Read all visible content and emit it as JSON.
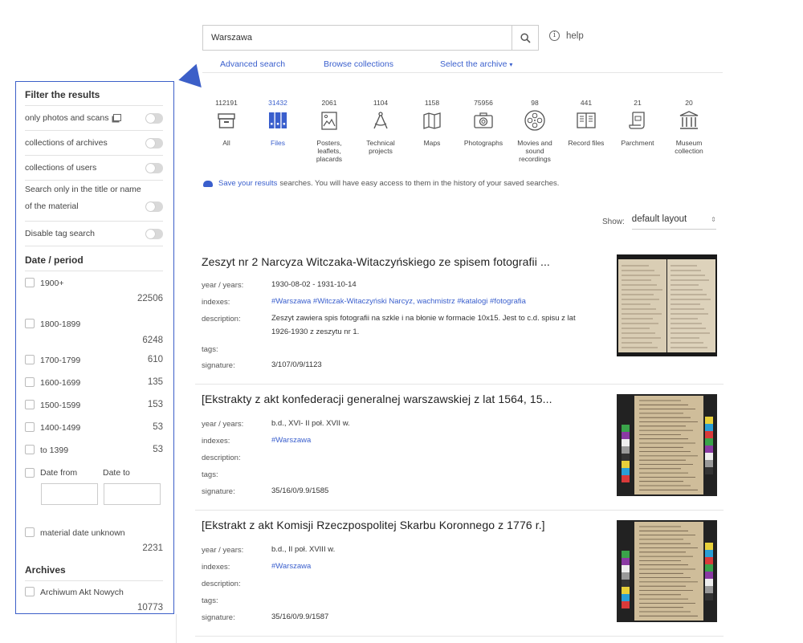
{
  "search": {
    "value": "Warszawa",
    "help_label": "help"
  },
  "top_links": {
    "advanced": "Advanced search",
    "browse": "Browse collections",
    "archive": "Select the archive"
  },
  "categories": [
    {
      "count": "112191",
      "label": "All",
      "icon": "box-icon",
      "active": false
    },
    {
      "count": "31432",
      "label": "Files",
      "icon": "files-icon",
      "active": true
    },
    {
      "count": "2061",
      "label": "Posters, leaflets, placards",
      "icon": "poster-icon",
      "active": false
    },
    {
      "count": "1104",
      "label": "Technical projects",
      "icon": "compass-icon",
      "active": false
    },
    {
      "count": "1158",
      "label": "Maps",
      "icon": "map-icon",
      "active": false
    },
    {
      "count": "75956",
      "label": "Photographs",
      "icon": "camera-icon",
      "active": false
    },
    {
      "count": "98",
      "label": "Movies and sound recordings",
      "icon": "film-reel-icon",
      "active": false
    },
    {
      "count": "441",
      "label": "Record files",
      "icon": "record-files-icon",
      "active": false
    },
    {
      "count": "21",
      "label": "Parchment",
      "icon": "parchment-icon",
      "active": false
    },
    {
      "count": "20",
      "label": "Museum collection",
      "icon": "museum-icon",
      "active": false
    }
  ],
  "save_note": {
    "link": "Save your results",
    "text": "searches. You will have easy access to them in the history of your saved searches."
  },
  "show": {
    "label": "Show:",
    "value": "default layout"
  },
  "sidebar": {
    "title": "Filter the results",
    "toggles": [
      {
        "label": "only photos and scans"
      },
      {
        "label": "collections of archives"
      },
      {
        "label": "collections of users"
      },
      {
        "label": "Search only in the title or name of the material"
      },
      {
        "label": "Disable tag search"
      }
    ],
    "date_title": "Date / period",
    "periods": [
      {
        "label": "1900+",
        "count": "22506"
      },
      {
        "label": "1800-1899",
        "count": "6248"
      },
      {
        "label": "1700-1799",
        "count": "610"
      },
      {
        "label": "1600-1699",
        "count": "135"
      },
      {
        "label": "1500-1599",
        "count": "153"
      },
      {
        "label": "1400-1499",
        "count": "53"
      },
      {
        "label": "to 1399",
        "count": "53"
      }
    ],
    "date_from": "Date from",
    "date_to": "Date to",
    "unknown": {
      "label": "material date unknown",
      "count": "2231"
    },
    "archives_title": "Archives",
    "archive_item": {
      "label": "Archiwum Akt Nowych",
      "count": "10773"
    }
  },
  "field_labels": {
    "years": "year / years:",
    "indexes": "indexes:",
    "description": "description:",
    "tags": "tags:",
    "signature": "signature:"
  },
  "results": [
    {
      "title": "Zeszyt nr 2 Narcyza Witczaka-Witaczyńskiego ze spisem fotografii ...",
      "years": "1930-08-02 - 1931-10-14",
      "indexes": "#Warszawa #Witczak-Witaczyński Narcyz, wachmistrz #katalogi #fotografia",
      "description": "Zeszyt zawiera spis fotografii na szkle i na błonie w formacie 10x15. Jest to c.d. spisu z lat 1926-1930 z zeszytu nr 1.",
      "tags": "",
      "signature": "3/107/0/9/1123"
    },
    {
      "title": "[Ekstrakty z akt konfederacji generalnej warszawskiej z lat 1564, 15...",
      "years": "b.d., XVI- II poł. XVII w.",
      "indexes": "#Warszawa",
      "description": "",
      "tags": "",
      "signature": "35/16/0/9.9/1585"
    },
    {
      "title": "[Ekstrakt z akt Komisji Rzeczpospolitej Skarbu Koronnego z 1776 r.]",
      "years": "b.d., II poł. XVIII w.",
      "indexes": "#Warszawa",
      "description": "",
      "tags": "",
      "signature": "35/16/0/9.9/1587"
    }
  ]
}
